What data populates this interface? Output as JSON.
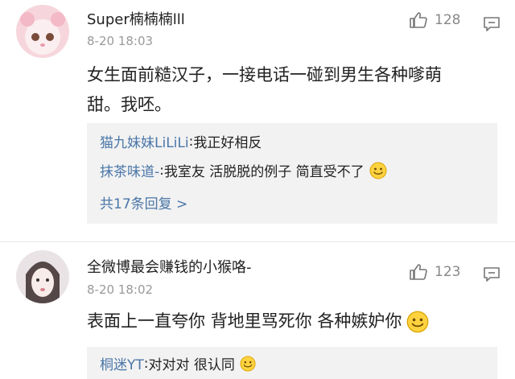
{
  "comments": [
    {
      "username": "Super楠楠楠lll",
      "time": "8-20 18:03",
      "likes": "128",
      "text_line1": "女生面前糙汉子，一接电话一碰到男生各种嗲萌",
      "text_line2": "甜。我呸。",
      "replies": [
        {
          "name": "猫九妹妹LiLiLi",
          "sep": ": ",
          "text": "我正好相反"
        },
        {
          "name": "抹茶味道-",
          "sep": ": ",
          "text": "我室友 活脱脱的例子 简直受不了"
        }
      ],
      "more_replies": "共17条回复 >"
    },
    {
      "username": "全微博最会赚钱的小猴咯-",
      "time": "8-20 18:02",
      "likes": "123",
      "text_line1": "表面上一直夸你 背地里骂死你 各种嫉妒你",
      "replies": [
        {
          "name": "桐迷YT",
          "sep": ": ",
          "text": "对对对 很认同"
        }
      ]
    }
  ],
  "icons": {
    "like": "thumbs-up-icon",
    "reply": "comment-icon",
    "emoji": "smiley-emoji-icon"
  },
  "colors": {
    "link": "#4a76a8",
    "reply_bg": "#f2f2f2",
    "meta": "#999999"
  }
}
